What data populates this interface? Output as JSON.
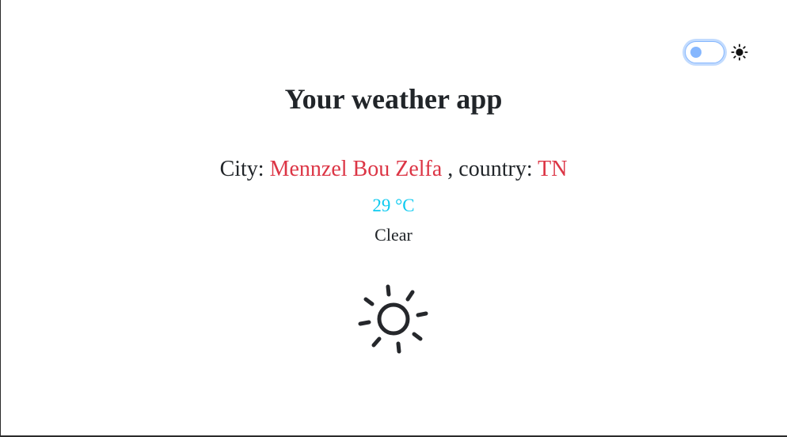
{
  "app": {
    "title": "Your weather app"
  },
  "theme_toggle": {
    "checked": false,
    "icon": "sun-icon"
  },
  "location": {
    "city_label": "City:",
    "city": "Mennzel Bou Zelfa",
    "country_label": ", country:",
    "country": "TN"
  },
  "weather": {
    "temperature": "29 °C",
    "condition": "Clear",
    "icon": "sun-icon"
  },
  "colors": {
    "accent_red": "#dc3545",
    "temperature_cyan": "#0dcaf0",
    "toggle_blue": "#86b7fe",
    "text": "#212529"
  }
}
